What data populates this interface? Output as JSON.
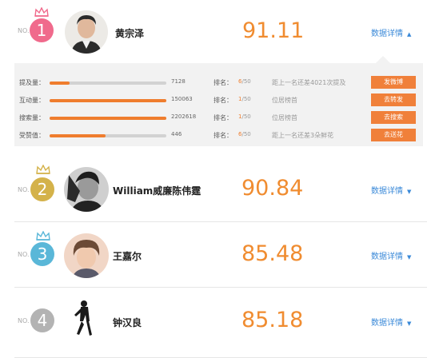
{
  "no_prefix": "NO.",
  "colors": {
    "accent": "#f08c30",
    "link": "#3a89d8",
    "gold": "#d4b24a",
    "blue": "#5ab7d8",
    "grey": "#b3b3b3",
    "pink": "#f06a8c"
  },
  "entries": [
    {
      "rank": "1",
      "name": "黄宗泽",
      "score": "91.11",
      "detail_label": "数据详情",
      "expanded": true,
      "arrow": "▲"
    },
    {
      "rank": "2",
      "name": "William威廉陈伟霆",
      "score": "90.84",
      "detail_label": "数据详情",
      "expanded": false,
      "arrow": "▼"
    },
    {
      "rank": "3",
      "name": "王嘉尔",
      "score": "85.48",
      "detail_label": "数据详情",
      "expanded": false,
      "arrow": "▼"
    },
    {
      "rank": "4",
      "name": "钟汉良",
      "score": "85.18",
      "detail_label": "数据详情",
      "expanded": false,
      "arrow": "▼"
    }
  ],
  "details": {
    "rank_label": "排名：",
    "stats": [
      {
        "label": "提及量：",
        "level": 0.17,
        "value": "7128",
        "rank_current": "6",
        "rank_total": "/50",
        "note": "距上一名还差4021次提及",
        "action": "发微博"
      },
      {
        "label": "互动量：",
        "level": 1.0,
        "value": "150063",
        "rank_current": "1",
        "rank_total": "/50",
        "note": "位居榜首",
        "action": "去转发"
      },
      {
        "label": "搜索量：",
        "level": 1.0,
        "value": "2202618",
        "rank_current": "1",
        "rank_total": "/50",
        "note": "位居榜首",
        "action": "去搜索"
      },
      {
        "label": "受赞值：",
        "level": 0.48,
        "value": "446",
        "rank_current": "6",
        "rank_total": "/50",
        "note": "距上一名还差3朵鲜花",
        "action": "去送花"
      }
    ]
  }
}
